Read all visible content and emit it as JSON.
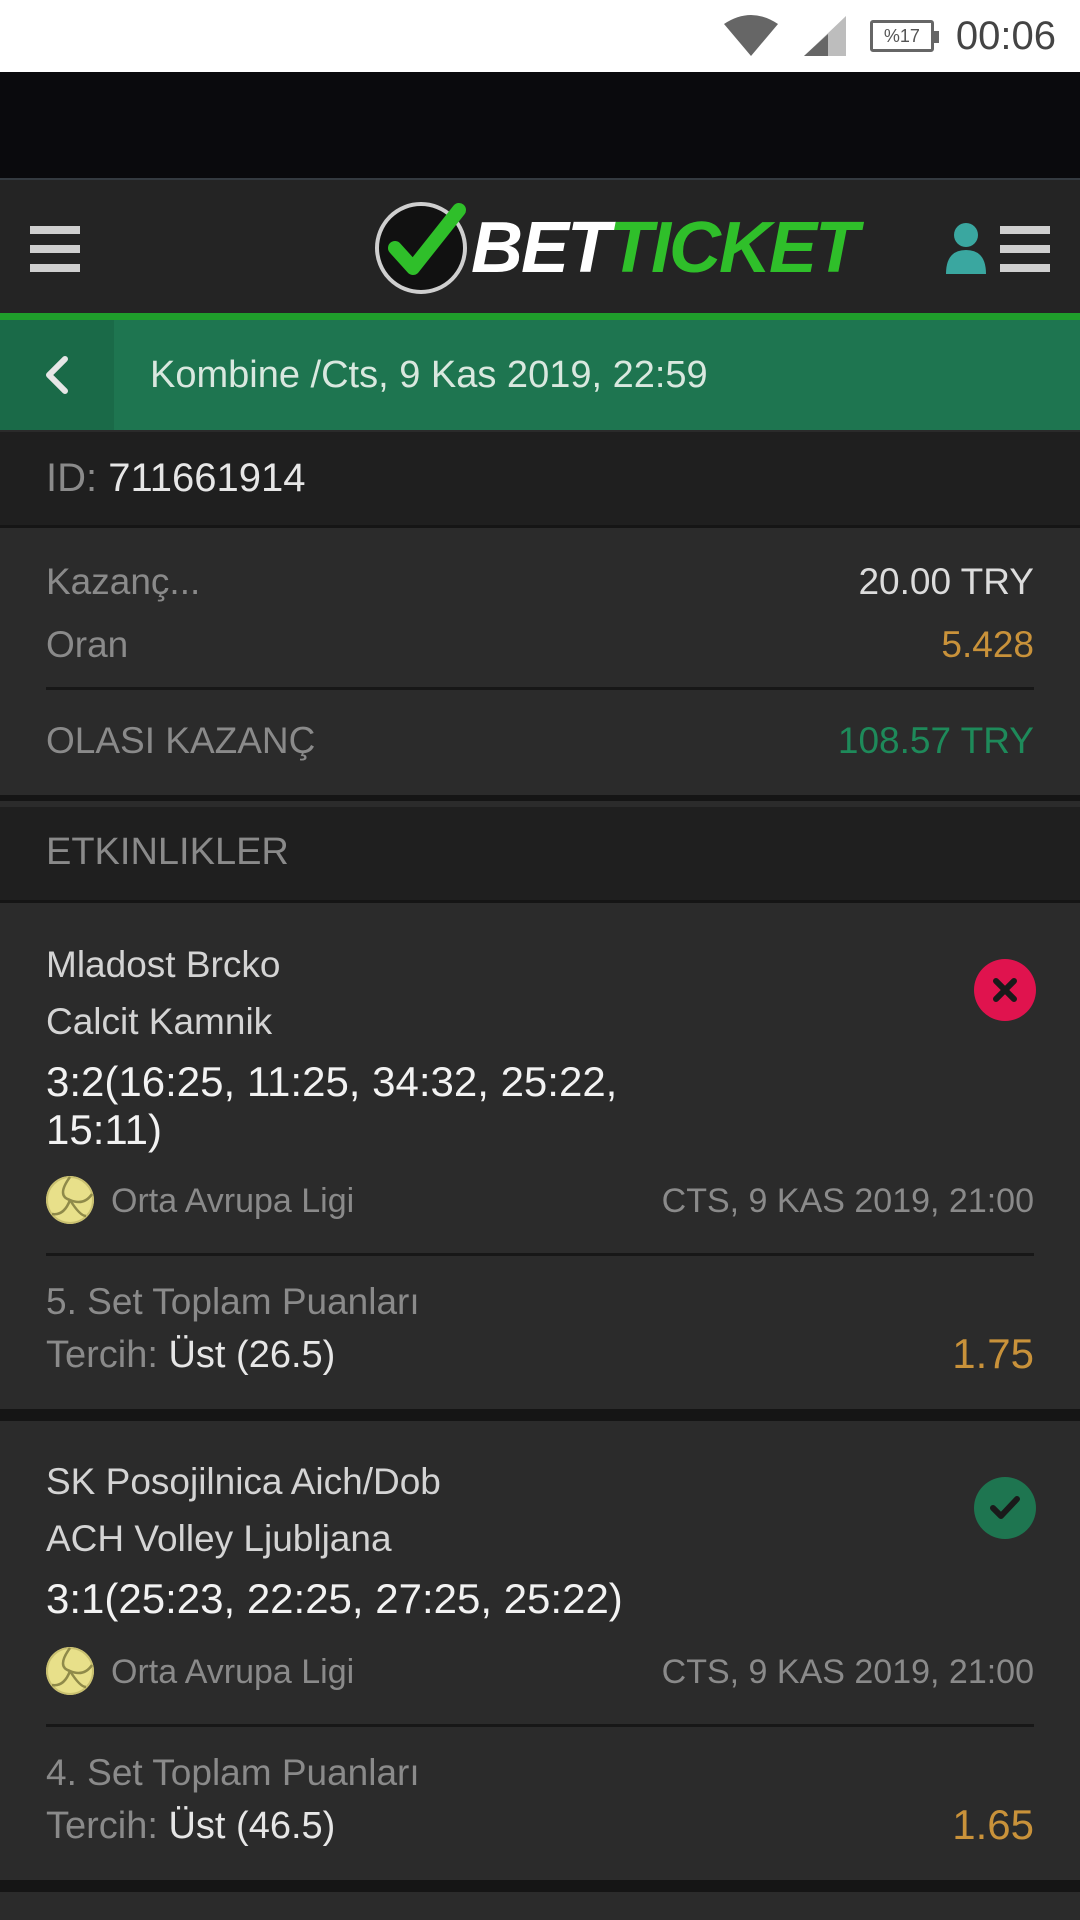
{
  "status_bar": {
    "time": "00:06",
    "battery": "%17",
    "icons": [
      "wifi-icon",
      "signal-icon",
      "battery-icon"
    ]
  },
  "header": {
    "logo_bet": "BET",
    "logo_ticket": "TICKET",
    "icons": [
      "menu-icon",
      "user-icon",
      "menu-icon"
    ]
  },
  "title_bar": {
    "title": "Kombine /Cts, 9 Kas 2019, 22:59"
  },
  "ticket": {
    "id_label": "ID:",
    "id_value": "711661914"
  },
  "summary": {
    "stake_label": "Kazanç...",
    "stake_value": "20.00 TRY",
    "odds_label": "Oran",
    "odds_value": "5.428",
    "potential_label": "OLASI KAZANÇ",
    "potential_value": "108.57 TRY"
  },
  "events_header": "ETKINLIKLER",
  "events": [
    {
      "home": "Mladost Brcko",
      "away": "Calcit Kamnik",
      "score": "3:2(16:25, 11:25, 34:32, 25:22, 15:11)",
      "league": "Orta Avrupa Ligi",
      "date": "CTS, 9 KAS 2019, 21:00",
      "market": "5. Set Toplam Puanları",
      "pick_label": "Tercih:",
      "pick_value": "Üst (26.5)",
      "odds": "1.75",
      "result": "lost"
    },
    {
      "home": "SK Posojilnica Aich/Dob",
      "away": "ACH Volley Ljubljana",
      "score": "3:1(25:23, 22:25, 27:25, 25:22)",
      "league": "Orta Avrupa Ligi",
      "date": "CTS, 9 KAS 2019, 21:00",
      "market": "4. Set Toplam Puanları",
      "pick_label": "Tercih:",
      "pick_value": "Üst (46.5)",
      "odds": "1.65",
      "result": "won"
    }
  ],
  "colors": {
    "brand_green": "#1f9e2b",
    "title_bar": "#1e7550",
    "odds": "#c9923a",
    "potential": "#1e8a5a",
    "lost": "#e0134e",
    "won": "#1e7550"
  }
}
